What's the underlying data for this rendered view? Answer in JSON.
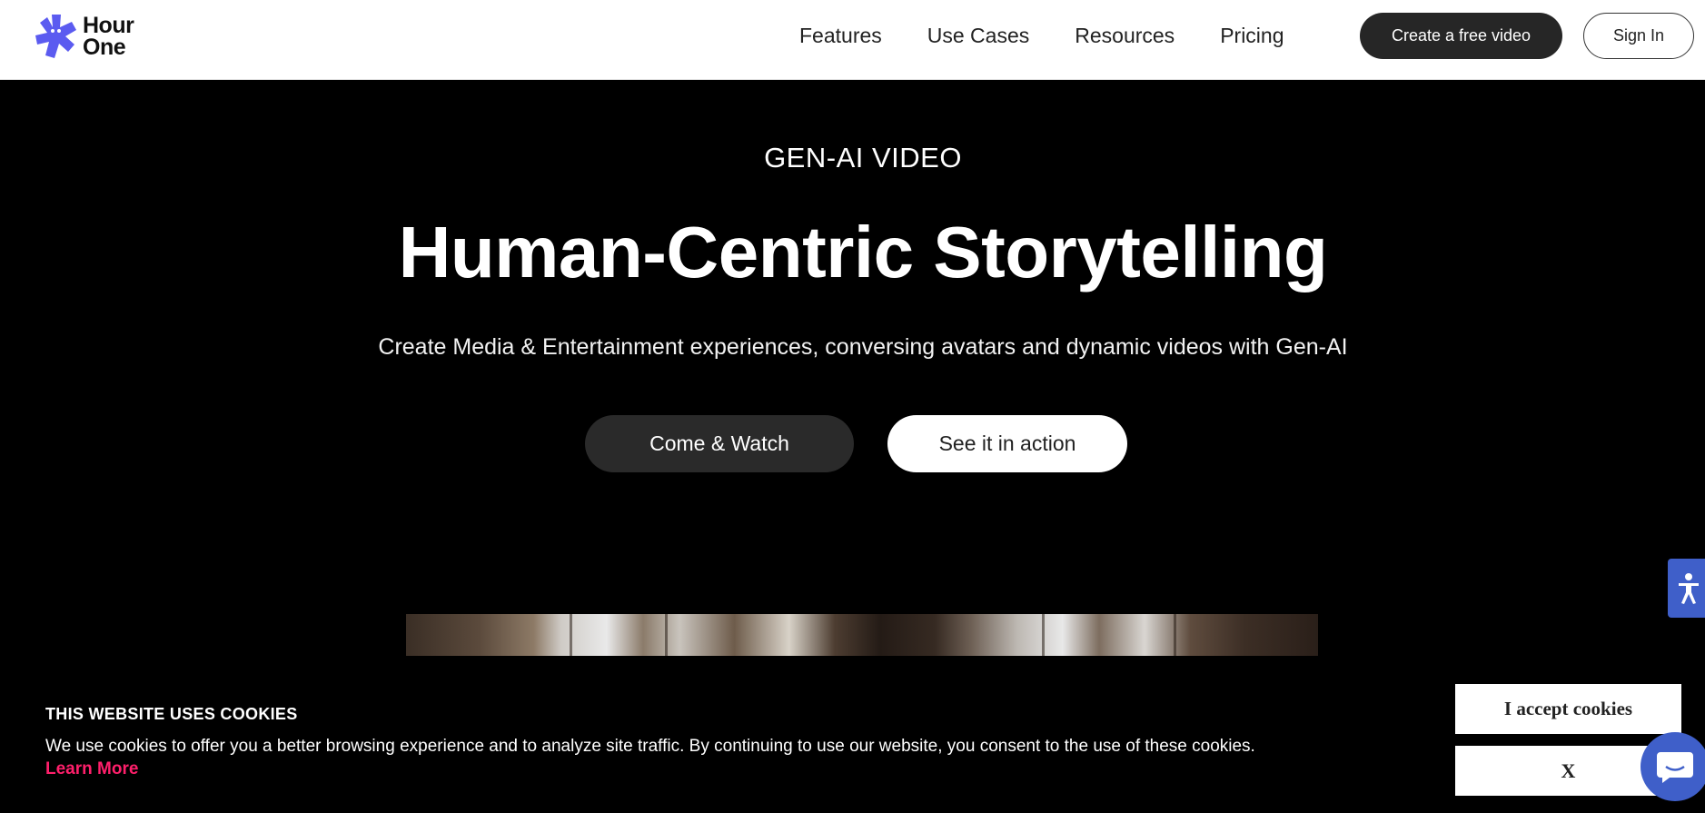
{
  "header": {
    "logo_line1": "Hour",
    "logo_line2": "One",
    "nav": [
      "Features",
      "Use Cases",
      "Resources",
      "Pricing"
    ],
    "create_button": "Create a free video",
    "signin_button": "Sign In"
  },
  "hero": {
    "eyebrow": "GEN-AI VIDEO",
    "title": "Human-Centric Storytelling",
    "subtitle": "Create Media & Entertainment experiences, conversing avatars and dynamic videos with Gen-AI",
    "primary_button": "Come & Watch",
    "secondary_button": "See it in action"
  },
  "cookie": {
    "title": "THIS WEBSITE USES COOKIES",
    "text": "We use cookies to offer you a better browsing experience and to analyze site traffic. By continuing to use our website, you consent to the use of these cookies.",
    "learn_more": "Learn More",
    "accept_button": "I accept cookies",
    "close_button": "X"
  },
  "icons": {
    "logo": "hour-one-logo-icon",
    "accessibility": "accessibility-icon",
    "chat": "chat-icon"
  },
  "colors": {
    "brand": "#5b5bf0",
    "accessibility": "#3f5fc9",
    "learn_more": "#ff1f6b",
    "dark_button": "#262626"
  }
}
